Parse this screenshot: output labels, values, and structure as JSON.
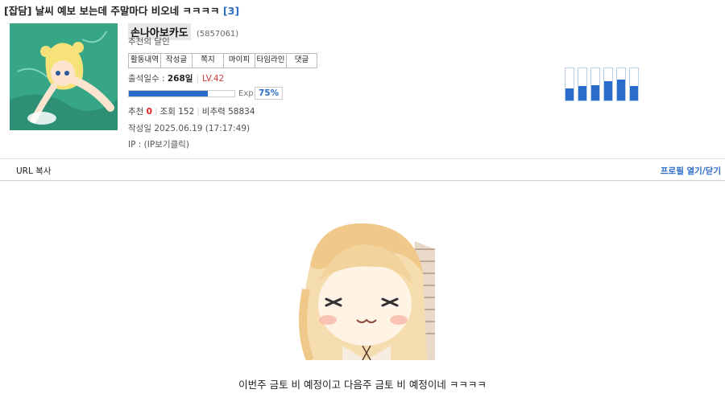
{
  "post": {
    "category": "[잡담]",
    "title": "날씨 예보 보는데 주말마다 비오네 ㅋㅋㅋㅋ",
    "comment_count": "[3]",
    "body_text": "이번주 금토 비 예정이고 다음주 금토 비 예정이네 ㅋㅋㅋㅋ"
  },
  "author": {
    "nickname": "손나아보카도",
    "user_id": "(5857061)",
    "rank": "추천의 달인",
    "menu": [
      "활동내역",
      "작성글",
      "쪽지",
      "마이피",
      "타임라인",
      "댓글"
    ],
    "attendance_label": "출석일수 :",
    "attendance_value": "268일",
    "level": "LV.42",
    "exp_label": "Exp.",
    "exp_percent": "75%",
    "exp_fraction": 0.75,
    "activity_levels": [
      0.38,
      0.45,
      0.48,
      0.6,
      0.65,
      0.45
    ]
  },
  "stats": {
    "recommend_label": "추천",
    "recommend_value": "0",
    "views_label": "조회",
    "views_value": "152",
    "ratio_label": "비추력",
    "ratio_value": "58834"
  },
  "meta": {
    "date_label": "작성일",
    "date_value": "2025.06.19 (17:17:49)",
    "ip_label": "IP :",
    "ip_value": "(IP보기클릭)"
  },
  "actions": {
    "url_copy": "URL 복사",
    "profile_toggle": "프로필 열기/닫기"
  },
  "colors": {
    "accent": "#2a6cc9",
    "level": "#d03a3a",
    "recommend": "#e02020"
  }
}
